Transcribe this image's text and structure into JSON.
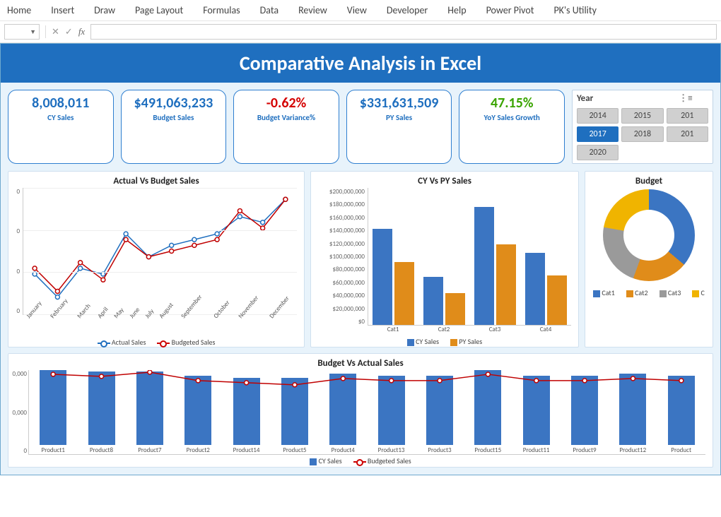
{
  "ribbon": {
    "tabs": [
      "Home",
      "Insert",
      "Draw",
      "Page Layout",
      "Formulas",
      "Data",
      "Review",
      "View",
      "Developer",
      "Help",
      "Power Pivot",
      "PK's Utility"
    ]
  },
  "formula_bar": {
    "name_box": "",
    "fx_label": "fx",
    "formula": ""
  },
  "title": "Comparative Analysis in Excel",
  "kpis": [
    {
      "value": "8,008,011",
      "label": "CY Sales",
      "tone": ""
    },
    {
      "value": "$491,063,233",
      "label": "Budget Sales",
      "tone": ""
    },
    {
      "value": "-0.62%",
      "label": "Budget Variance%",
      "tone": "neg"
    },
    {
      "value": "$331,631,509",
      "label": "PY Sales",
      "tone": ""
    },
    {
      "value": "47.15%",
      "label": "YoY Sales Growth",
      "tone": "pos"
    }
  ],
  "slicer": {
    "title": "Year",
    "items": [
      "2014",
      "2015",
      "201",
      "2017",
      "2018",
      "201",
      "2020"
    ],
    "selected": "2017"
  },
  "chart_data": [
    {
      "id": "actual_vs_budget",
      "type": "line",
      "title": "Actual Vs Budget Sales",
      "x": [
        "January",
        "February",
        "March",
        "April",
        "May",
        "June",
        "July",
        "August",
        "September",
        "October",
        "November",
        "December"
      ],
      "series": [
        {
          "name": "Actual Sales",
          "color": "#1f6fbf",
          "values": [
            37000000,
            33000000,
            38000000,
            37000000,
            44000000,
            40000000,
            42000000,
            43000000,
            44000000,
            47000000,
            46000000,
            50000000
          ]
        },
        {
          "name": "Budgeted Sales",
          "color": "#c00000",
          "values": [
            38000000,
            34000000,
            39000000,
            36000000,
            43000000,
            40000000,
            41000000,
            42000000,
            43000000,
            48000000,
            45000000,
            50000000
          ]
        }
      ],
      "yticks": [
        "0",
        "0",
        "0",
        "0"
      ],
      "ylim": [
        30000000,
        52000000
      ],
      "legend": [
        "Actual Sales",
        "Budgeted Sales"
      ]
    },
    {
      "id": "cy_vs_py",
      "type": "bar",
      "title": "CY Vs PY Sales",
      "categories": [
        "Cat1",
        "Cat2",
        "Cat3",
        "Cat4"
      ],
      "series": [
        {
          "name": "CY Sales",
          "color": "#3b75c2",
          "values": [
            140000000,
            70000000,
            172000000,
            105000000
          ]
        },
        {
          "name": "PY Sales",
          "color": "#e08c1a",
          "values": [
            92000000,
            46000000,
            118000000,
            72000000
          ]
        }
      ],
      "ylim": [
        0,
        200000000
      ],
      "yticks": [
        "$0",
        "$20,000,000",
        "$40,000,000",
        "$60,000,000",
        "$80,000,000",
        "$100,000,000",
        "$120,000,000",
        "$140,000,000",
        "$160,000,000",
        "$180,000,000",
        "$200,000,000"
      ],
      "legend": [
        "CY Sales",
        "PY Sales"
      ]
    },
    {
      "id": "budget_donut",
      "type": "pie",
      "title": "Budget",
      "categories": [
        "Cat1",
        "Cat2",
        "Cat3",
        "C"
      ],
      "values": [
        36,
        19,
        22,
        23
      ],
      "colors": [
        "#3b75c2",
        "#e08c1a",
        "#9a9a9a",
        "#f0b400"
      ],
      "legend": [
        "Cat1",
        "Cat2",
        "Cat3",
        "C"
      ]
    },
    {
      "id": "budget_vs_actual_products",
      "type": "bar",
      "title": "Budget Vs Actual Sales",
      "categories": [
        "Product1",
        "Product8",
        "Product7",
        "Product2",
        "Product14",
        "Product5",
        "Product4",
        "Product13",
        "Product3",
        "Product15",
        "Product11",
        "Product9",
        "Product12",
        "Product"
      ],
      "series": [
        {
          "name": "CY Sales",
          "color": "#3b75c2",
          "values": [
            36000,
            35000,
            35000,
            33000,
            32000,
            32000,
            34000,
            33000,
            33000,
            36000,
            33000,
            33000,
            34000,
            33000
          ]
        },
        {
          "name": "Budgeted Sales",
          "color": "#c00000",
          "values": [
            38000,
            37000,
            39000,
            35000,
            34000,
            33000,
            36000,
            35000,
            35000,
            38000,
            35000,
            35000,
            36000,
            35000
          ]
        }
      ],
      "ylim": [
        0,
        40000
      ],
      "yticks": [
        "0",
        "0,000",
        "0,000"
      ],
      "legend": [
        "CY Sales",
        "Budgeted Sales"
      ]
    }
  ]
}
